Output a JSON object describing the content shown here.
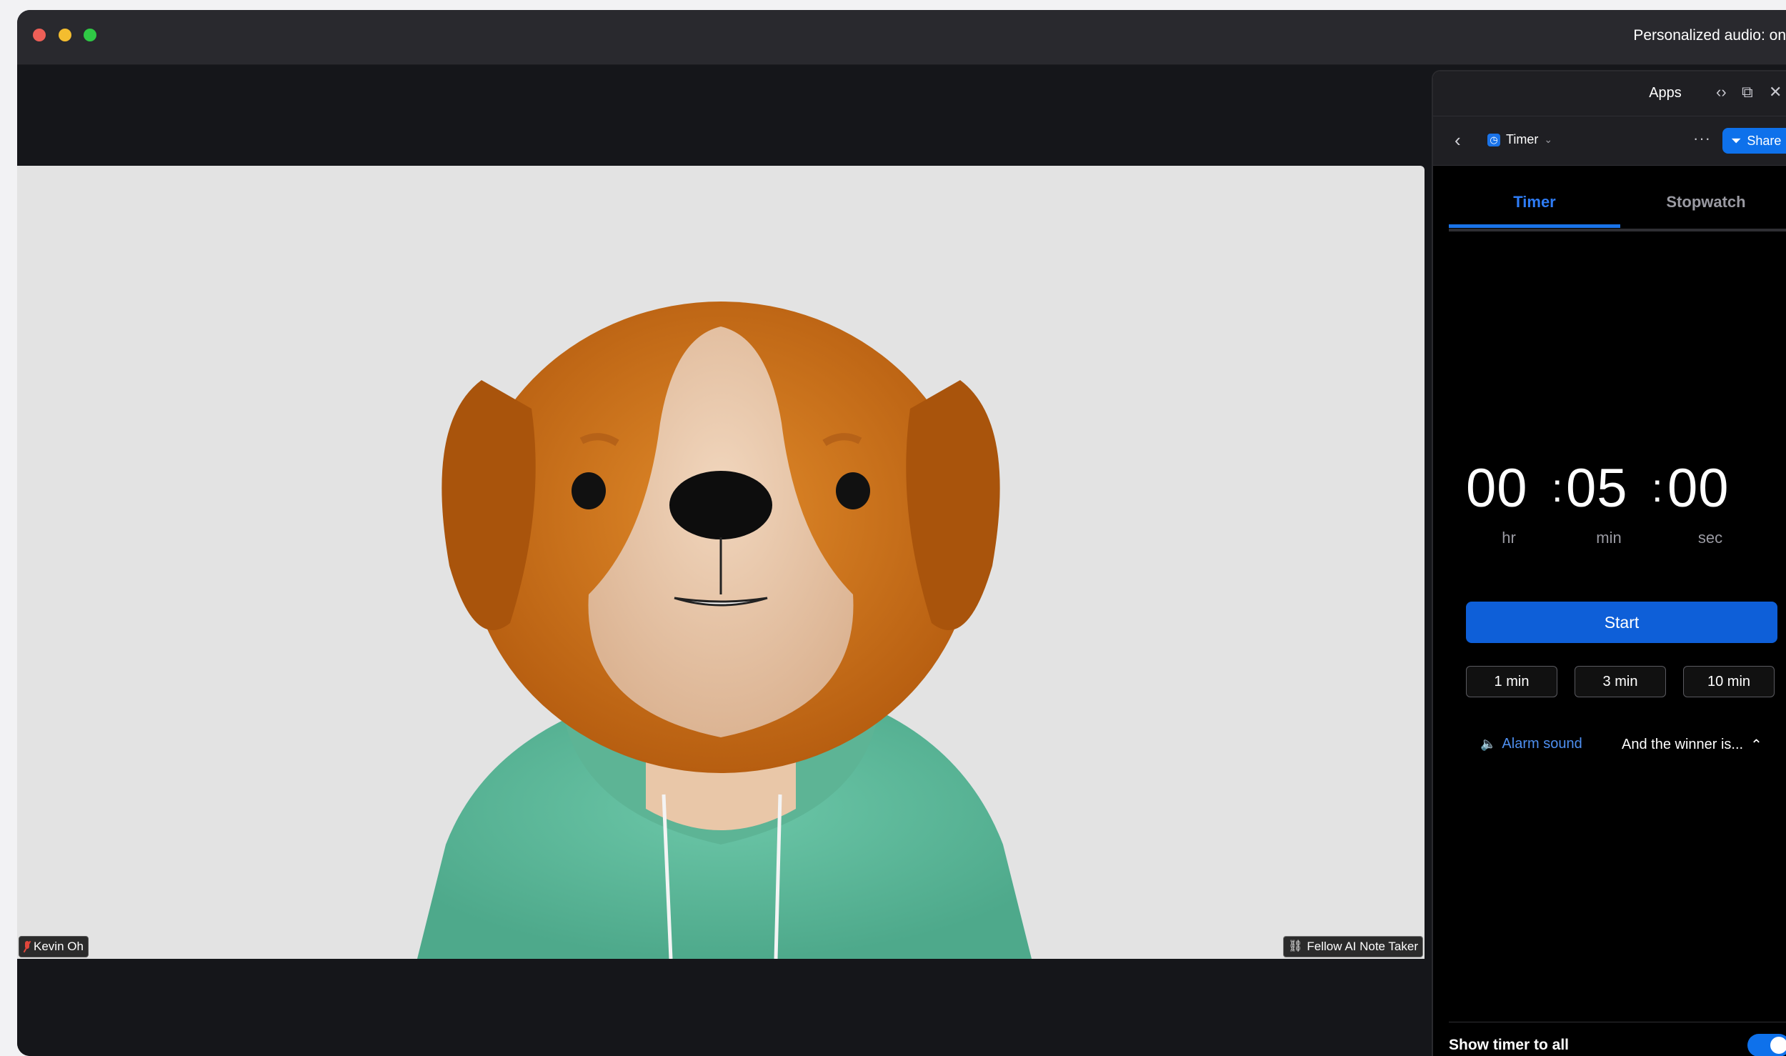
{
  "titlebar": {
    "status_text": "Personalized audio: on"
  },
  "participants": {
    "main_name": "Kevin Oh",
    "notetaker_label": "Fellow AI Note Taker"
  },
  "apps_panel": {
    "title": "Apps",
    "app_name": "Timer",
    "share_label": "Share",
    "tabs": [
      "Timer",
      "Stopwatch"
    ],
    "active_tab": "Timer",
    "timer": {
      "hours": "00",
      "minutes": "05",
      "seconds": "00",
      "unit_hr": "hr",
      "unit_min": "min",
      "unit_sec": "sec"
    },
    "start_label": "Start",
    "presets": [
      "1 min",
      "3 min",
      "10 min"
    ],
    "alarm_label": "Alarm sound",
    "alarm_value": "And the winner is...",
    "show_timer_label": "Show timer to all",
    "show_timer_enabled": true
  },
  "colors": {
    "accent": "#0e71eb",
    "muted_red": "#e0463b",
    "hoodie": "#5fb89a",
    "fur": "#c8670f"
  }
}
